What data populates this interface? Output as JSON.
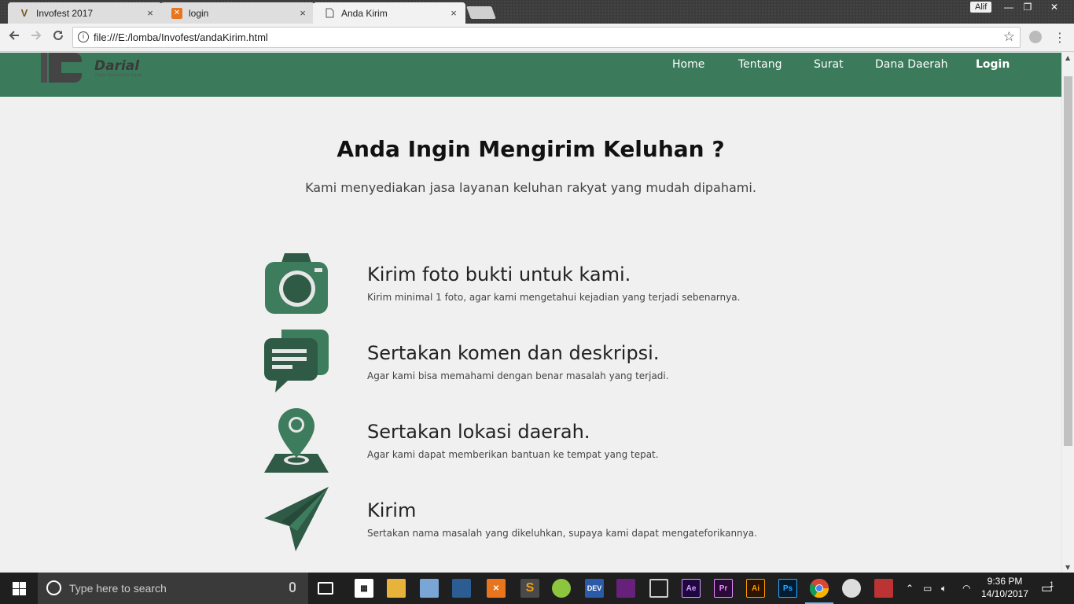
{
  "browser": {
    "tabs": [
      {
        "title": "Invofest 2017",
        "favicon": "invofest-v-icon",
        "active": false
      },
      {
        "title": "login",
        "favicon": "xampp-icon",
        "active": false
      },
      {
        "title": "Anda Kirim",
        "favicon": "page-icon",
        "active": true
      }
    ],
    "close_glyph": "×",
    "profile_name": "Alif",
    "url": "file:///E:/lomba/Invofest/andaKirim.html"
  },
  "site": {
    "logo": {
      "wordmark": "Darial",
      "tagline": "Dana Pemerintah Tepat"
    },
    "nav": [
      {
        "label": "Home"
      },
      {
        "label": "Tentang"
      },
      {
        "label": "Surat"
      },
      {
        "label": "Dana Daerah"
      },
      {
        "label": "Login"
      }
    ],
    "heading": "Anda Ingin Mengirim Keluhan ?",
    "subheading": "Kami menyediakan jasa layanan keluhan rakyat yang mudah dipahami.",
    "features": [
      {
        "icon": "camera-icon",
        "title": "Kirim foto bukti untuk kami.",
        "desc": "Kirim minimal 1 foto, agar kami mengetahui kejadian yang terjadi sebenarnya."
      },
      {
        "icon": "chat-icon",
        "title": "Sertakan komen dan deskripsi.",
        "desc": "Agar kami bisa memahami dengan benar masalah yang terjadi."
      },
      {
        "icon": "location-pin-icon",
        "title": "Sertakan lokasi daerah.",
        "desc": "Agar kami dapat memberikan bantuan ke tempat yang tepat."
      },
      {
        "icon": "paper-plane-icon",
        "title": "Kirim",
        "desc": "Sertakan nama masalah yang dikeluhkan, supaya kami dapat mengateforikannya."
      }
    ],
    "colors": {
      "primary": "#3b7a5b",
      "icon_dark": "#2f5a45",
      "icon_mid": "#3e7c5e"
    }
  },
  "taskbar": {
    "search_placeholder": "Type here to search",
    "time": "9:36 PM",
    "date": "14/10/2017",
    "notifications_count": "1"
  }
}
